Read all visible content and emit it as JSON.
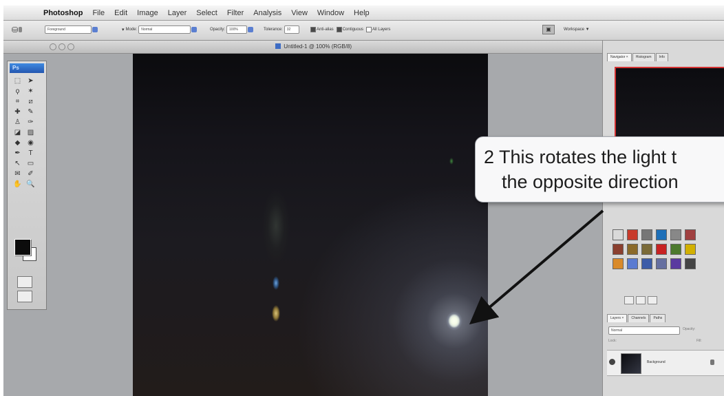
{
  "menubar": {
    "app_name": "Photoshop",
    "items": [
      "File",
      "Edit",
      "Image",
      "Layer",
      "Select",
      "Filter",
      "Analysis",
      "View",
      "Window",
      "Help"
    ]
  },
  "options_bar": {
    "fill_source": "Foreground",
    "mode_label": "Mode:",
    "mode_value": "Normal",
    "opacity_label": "Opacity:",
    "opacity_value": "100%",
    "tolerance_label": "Tolerance:",
    "tolerance_value": "32",
    "anti_alias_label": "Anti-alias",
    "contiguous_label": "Contiguous",
    "all_layers_label": "All Layers",
    "workspace_label": "Workspace ▼"
  },
  "document": {
    "title": "Untitled-1 @ 100% (RGB/8)"
  },
  "tools": {
    "logo": "Ps",
    "icons": [
      "marquee-icon",
      "move-icon",
      "lasso-icon",
      "magic-wand-icon",
      "crop-icon",
      "slice-icon",
      "healing-icon",
      "brush-icon",
      "stamp-icon",
      "history-brush-icon",
      "eraser-icon",
      "gradient-icon",
      "blur-icon",
      "dodge-icon",
      "pen-icon",
      "type-icon",
      "path-select-icon",
      "shape-icon",
      "notes-icon",
      "eyedropper-icon",
      "hand-icon",
      "zoom-icon"
    ],
    "glyphs": [
      "⬚",
      "➤",
      "ϙ",
      "✶",
      "⌗",
      "⧄",
      "✚",
      "✎",
      "♙",
      "✑",
      "◪",
      "▨",
      "◆",
      "◉",
      "✒",
      "T",
      "↖",
      "▭",
      "✉",
      "✐",
      "✋",
      "🔍"
    ]
  },
  "panels": {
    "top_tabs": [
      "Navigator ×",
      "Histogram",
      "Info"
    ],
    "layer_tabs": [
      "Layers ×",
      "Channels",
      "Paths"
    ],
    "layer_blend": "Normal",
    "layer_opacity_label": "Opacity:",
    "lock_label": "Lock:",
    "fill_label": "Fill:",
    "layer_name": "Background",
    "swatch_colors": [
      "#d9d9d9",
      "#c83a2a",
      "#777777",
      "#1d6fb8",
      "#888888",
      "#a04040",
      "#8a3f2f",
      "#8b6a2a",
      "#7a6a38",
      "#c72222",
      "#4d7a2e",
      "#d2b000",
      "#d98a2a",
      "#5a7bd1",
      "#3c5ca8",
      "#6670a0",
      "#5a3aa0",
      "#444444"
    ]
  },
  "callout": {
    "line1": "2 This rotates the light t",
    "line2": "the opposite direction"
  }
}
